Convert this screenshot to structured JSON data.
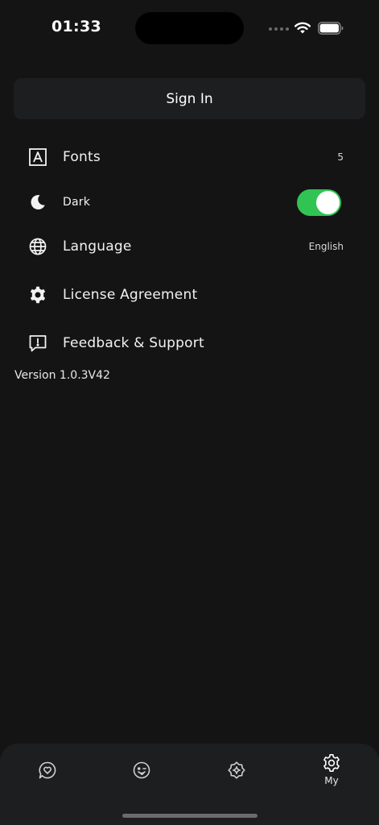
{
  "status_bar": {
    "time": "01:33"
  },
  "signin": {
    "label": "Sign In"
  },
  "settings": {
    "fonts": {
      "label": "Fonts",
      "value": "5"
    },
    "dark": {
      "label": "Dark",
      "enabled": true
    },
    "language": {
      "label": "Language",
      "value": "English"
    },
    "license": {
      "label": "License Agreement"
    },
    "feedback": {
      "label": "Feedback & Support"
    }
  },
  "version": "Version 1.0.3V42",
  "tabbar": {
    "tabs": [
      {
        "icon": "chat-heart-icon",
        "label": ""
      },
      {
        "icon": "wink-face-icon",
        "label": ""
      },
      {
        "icon": "sparkle-badge-icon",
        "label": ""
      },
      {
        "icon": "gear-icon",
        "label": "My",
        "active": true
      }
    ]
  },
  "colors": {
    "background": "#141415",
    "card": "#1d1e20",
    "toggle_on": "#31c453"
  }
}
